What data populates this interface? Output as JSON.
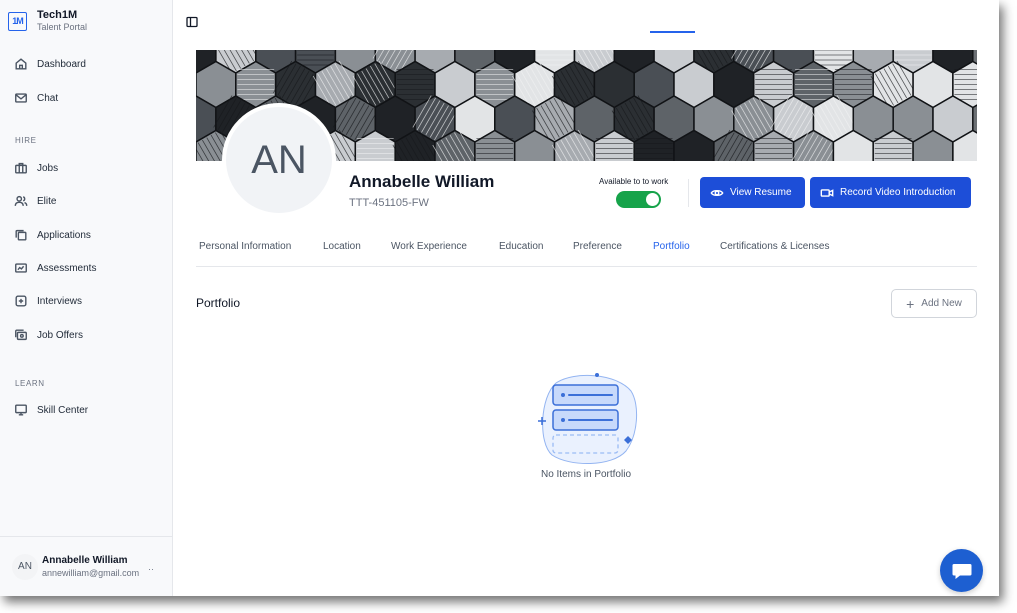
{
  "brand": {
    "logo_text": "1M",
    "name": "Tech1M",
    "subtitle": "Talent Portal"
  },
  "sidebar": {
    "top_items": [
      {
        "label": "Dashboard",
        "icon": "home-icon"
      },
      {
        "label": "Chat",
        "icon": "mail-icon"
      }
    ],
    "hire_section": "HIRE",
    "hire_items": [
      {
        "label": "Jobs",
        "icon": "briefcase-icon"
      },
      {
        "label": "Elite",
        "icon": "users-icon"
      },
      {
        "label": "Applications",
        "icon": "copy-icon"
      },
      {
        "label": "Assessments",
        "icon": "chart-box-icon"
      },
      {
        "label": "Interviews",
        "icon": "calendar-plus-icon"
      },
      {
        "label": "Job Offers",
        "icon": "offers-icon"
      }
    ],
    "learn_section": "LEARN",
    "learn_items": [
      {
        "label": "Skill Center",
        "icon": "monitor-icon"
      }
    ]
  },
  "user": {
    "initials": "AN",
    "name": "Annabelle William",
    "email": "annewilliam@gmail.com",
    "more": "··"
  },
  "profile": {
    "initials": "AN",
    "name": "Annabelle William",
    "id": "TTT-451105-FW",
    "availability_label": "Available to to work",
    "available": true
  },
  "actions": {
    "view_resume": "View Resume",
    "record_video": "Record Video Introduction"
  },
  "tabs": [
    {
      "label": "Personal Information",
      "active": false
    },
    {
      "label": "Location",
      "active": false
    },
    {
      "label": "Work Experience",
      "active": false
    },
    {
      "label": "Education",
      "active": false
    },
    {
      "label": "Preference",
      "active": false
    },
    {
      "label": "Portfolio",
      "active": true
    },
    {
      "label": "Certifications & Licenses",
      "active": false
    }
  ],
  "portfolio": {
    "title": "Portfolio",
    "add_label": "Add New",
    "empty_text": "No Items in Portfolio"
  },
  "colors": {
    "primary": "#1d4ed8",
    "accent": "#2563eb",
    "toggle_on": "#16a34a"
  }
}
